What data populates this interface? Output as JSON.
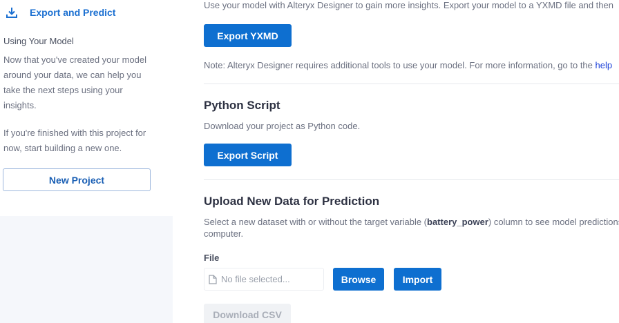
{
  "sidebar": {
    "nav_label": "Export and Predict",
    "heading": "Using Your Model",
    "para1": "Now that you've created your model around your data, we can help you take the next steps using your insights.",
    "para2": "If you're finished with this project for now, start building a new one.",
    "new_project": "New Project"
  },
  "main": {
    "intro": "Use your model with Alteryx Designer to gain more insights. Export your model to a YXMD file and then",
    "export_yxmd": "Export YXMD",
    "note": "Note: Alteryx Designer requires additional tools to use your model. For more information, go to the ",
    "note_link": "help",
    "python_heading": "Python Script",
    "python_desc": "Download your project as Python code.",
    "export_script": "Export Script",
    "upload_heading": "Upload New Data for Prediction",
    "upload_desc_pre": "Select a new dataset with or without the target variable (",
    "upload_desc_bold": "battery_power",
    "upload_desc_post": ") column to see model predictions",
    "upload_desc_line2": "computer.",
    "file_label": "File",
    "file_placeholder": "No file selected...",
    "browse": "Browse",
    "import": "Import",
    "download_csv": "Download CSV"
  }
}
